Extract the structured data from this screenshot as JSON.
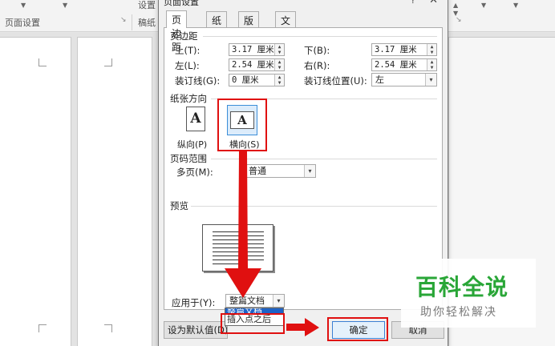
{
  "ribbon": {
    "left_group": "页面设置",
    "setup_label": "设置",
    "paper_label": "稿纸"
  },
  "dialog": {
    "title": "页面设置",
    "help": "?",
    "close": "✕",
    "tabs": [
      {
        "label": "页边距",
        "active": true
      },
      {
        "label": "纸张"
      },
      {
        "label": "版式"
      },
      {
        "label": "文档网格"
      }
    ]
  },
  "margins": {
    "section": "页边距",
    "top_label": "上(T):",
    "top_value": "3.17 厘米",
    "bottom_label": "下(B):",
    "bottom_value": "3.17 厘米",
    "left_label": "左(L):",
    "left_value": "2.54 厘米",
    "right_label": "右(R):",
    "right_value": "2.54 厘米",
    "gutter_label": "装订线(G):",
    "gutter_value": "0 厘米",
    "gutter_pos_label": "装订线位置(U):",
    "gutter_pos_value": "左"
  },
  "orientation": {
    "section": "纸张方向",
    "portrait_label": "纵向(P)",
    "landscape_label": "横向(S)",
    "glyph": "A",
    "selected": "landscape"
  },
  "pages": {
    "section": "页码范围",
    "multiple_label": "多页(M):",
    "multiple_value": "普通"
  },
  "preview": {
    "section": "预览"
  },
  "apply": {
    "label": "应用于(Y):",
    "value": "整篇文档",
    "options": [
      "整篇文档",
      "插入点之后"
    ]
  },
  "buttons": {
    "default": "设为默认值(D)",
    "ok": "确定",
    "cancel": "取消"
  },
  "watermark": {
    "title": "百科全说",
    "subtitle": "助你轻松解决"
  },
  "colors": {
    "highlight": "#e01010",
    "watermark_green": "#29a637",
    "selection_blue": "#1e63c8"
  }
}
